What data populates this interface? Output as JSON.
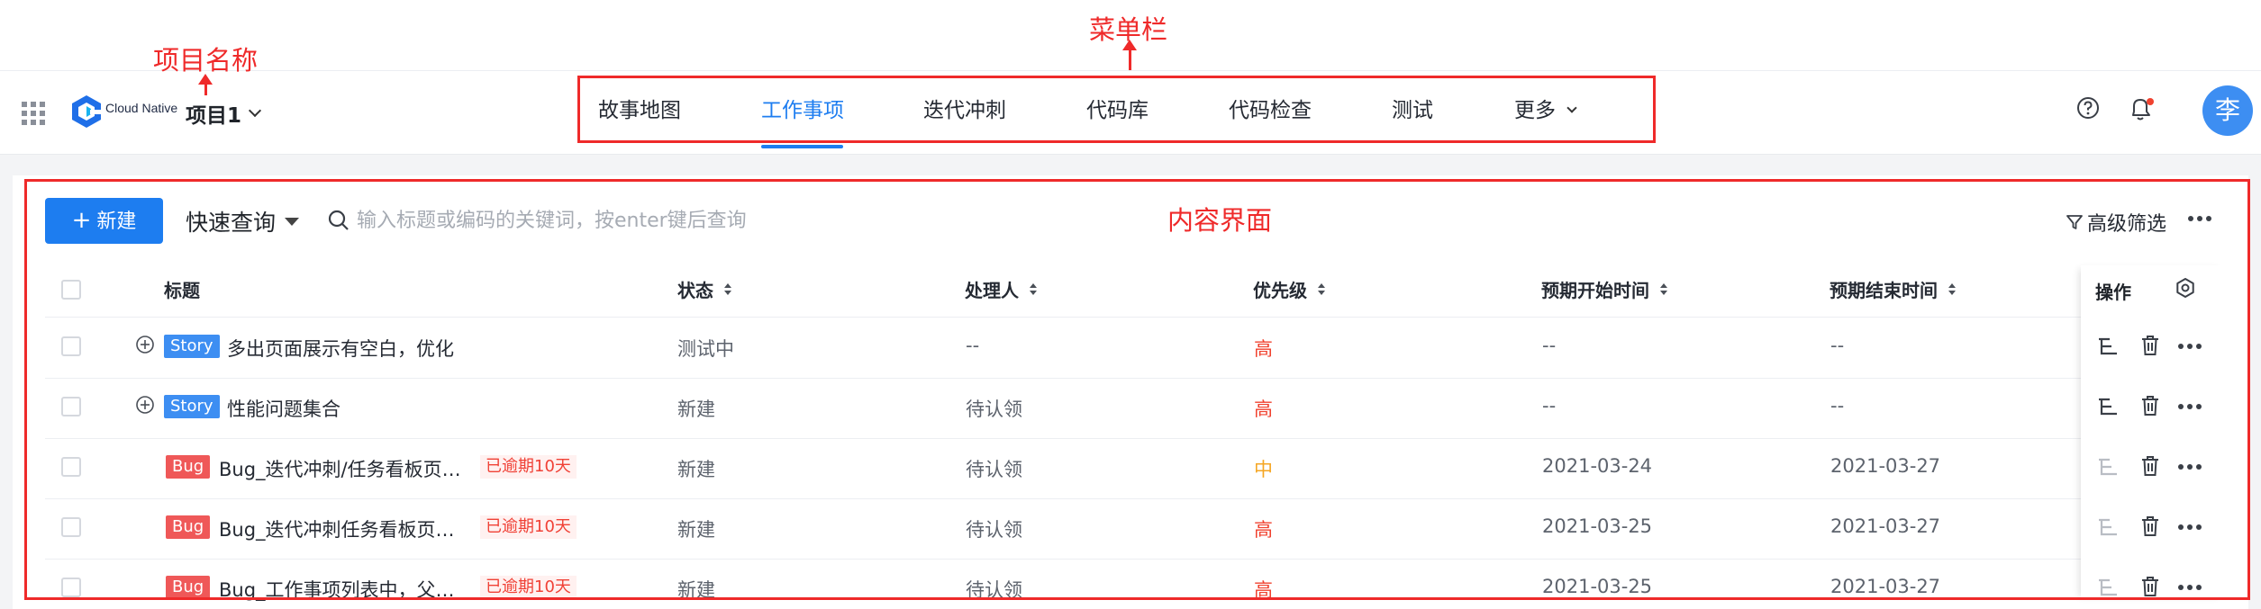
{
  "annotations": {
    "project_name": "项目名称",
    "menu_bar": "菜单栏",
    "content_area": "内容界面"
  },
  "header": {
    "logo_text": "Cloud Native",
    "project": "项目1",
    "menu": [
      {
        "label": "故事地图",
        "active": false
      },
      {
        "label": "工作事项",
        "active": true
      },
      {
        "label": "迭代冲刺",
        "active": false
      },
      {
        "label": "代码库",
        "active": false
      },
      {
        "label": "代码检查",
        "active": false
      },
      {
        "label": "测试",
        "active": false
      },
      {
        "label": "更多",
        "active": false
      }
    ],
    "avatar": "李"
  },
  "toolbar": {
    "new_label": "新建",
    "quick_query": "快速查询",
    "search_placeholder": "输入标题或编码的关键词，按enter键后查询",
    "filter_label": "高级筛选"
  },
  "table": {
    "columns": [
      "标题",
      "状态",
      "处理人",
      "优先级",
      "预期开始时间",
      "预期结束时间",
      "操作"
    ],
    "rows": [
      {
        "type": "Story",
        "title": "多出页面展示有空白，优化",
        "overdue": "",
        "status": "测试中",
        "assignee": "--",
        "priority": "高",
        "start": "--",
        "end": "--"
      },
      {
        "type": "Story",
        "title": "性能问题集合",
        "overdue": "",
        "status": "新建",
        "assignee": "待认领",
        "priority": "高",
        "start": "--",
        "end": "--"
      },
      {
        "type": "Bug",
        "title": "Bug_迭代冲刺/任务看板页…",
        "overdue": "已逾期10天",
        "status": "新建",
        "assignee": "待认领",
        "priority": "中",
        "start": "2021-03-24",
        "end": "2021-03-27"
      },
      {
        "type": "Bug",
        "title": "Bug_迭代冲刺任务看板页…",
        "overdue": "已逾期10天",
        "status": "新建",
        "assignee": "待认领",
        "priority": "高",
        "start": "2021-03-25",
        "end": "2021-03-27"
      },
      {
        "type": "Bug",
        "title": "Bug_工作事项列表中，父…",
        "overdue": "已逾期10天",
        "status": "新建",
        "assignee": "待认领",
        "priority": "高",
        "start": "2021-03-25",
        "end": "2021-03-27"
      }
    ]
  },
  "colors": {
    "accent": "#1d7df0",
    "annotation": "#ef2a2a",
    "priority_high": "#f0422f",
    "priority_medium": "#f5a623",
    "story_tag": "#3d8ef2",
    "bug_tag": "#ef5858"
  }
}
